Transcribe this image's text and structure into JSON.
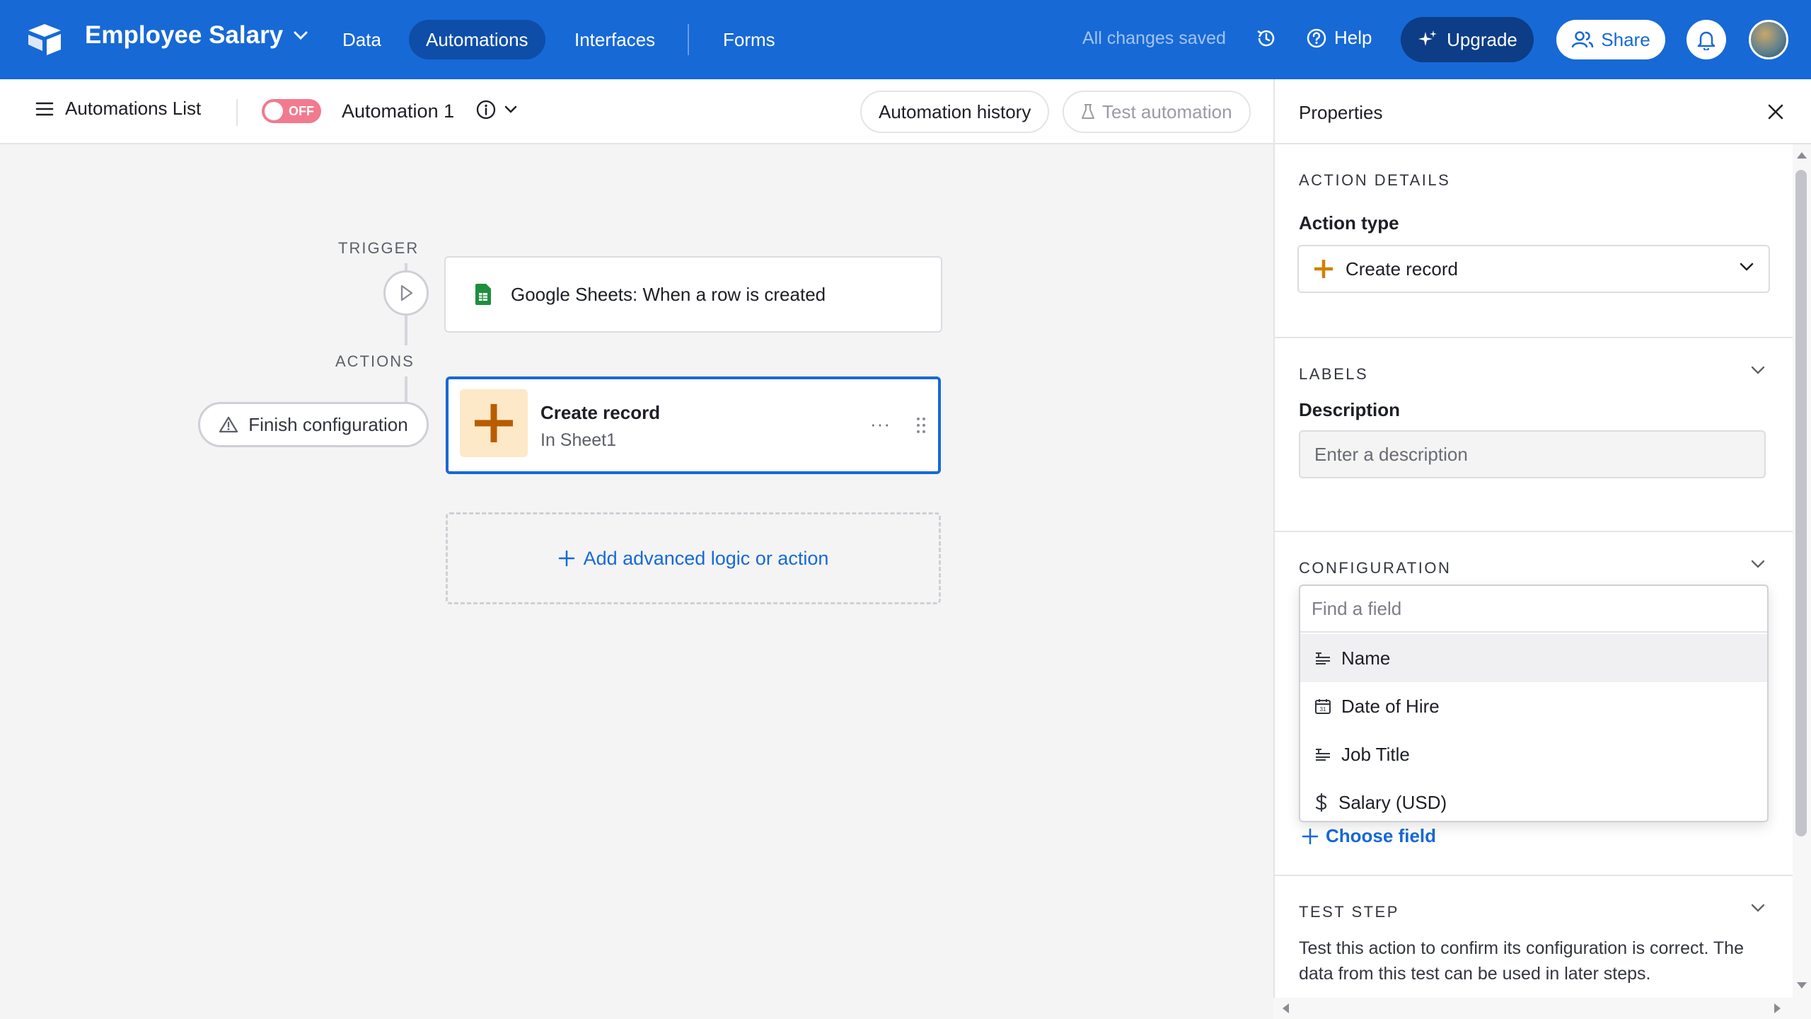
{
  "topbar": {
    "base_title": "Employee Salary",
    "tabs": [
      {
        "label": "Data"
      },
      {
        "label": "Automations",
        "active": true
      },
      {
        "label": "Interfaces"
      },
      {
        "label": "Forms"
      }
    ],
    "save_status": "All changes saved",
    "help_label": "Help",
    "upgrade_label": "Upgrade",
    "share_label": "Share",
    "colors": {
      "primary": "#1769d6",
      "active_tab": "#0e4ea9",
      "upgrade_bg": "#0d3d86"
    }
  },
  "subheader": {
    "list_label": "Automations List",
    "toggle_label": "OFF",
    "automation_name": "Automation 1",
    "history_label": "Automation history",
    "test_label": "Test automation"
  },
  "canvas": {
    "trigger_label": "TRIGGER",
    "actions_label": "ACTIONS",
    "trigger_text": "Google Sheets: When a row is created",
    "finish_label": "Finish configuration",
    "action": {
      "title": "Create record",
      "subtitle": "In Sheet1",
      "more": "···"
    },
    "add_logic_label": "Add advanced logic or action"
  },
  "panel": {
    "title": "Properties",
    "action_details_label": "ACTION DETAILS",
    "action_type_label": "Action type",
    "action_type_value": "Create record",
    "labels_section": "LABELS",
    "description_label": "Description",
    "description_placeholder": "Enter a description",
    "configuration_section": "CONFIGURATION",
    "find_placeholder": "Find a field",
    "fields": [
      {
        "label": "Name",
        "icon": "text-field-icon"
      },
      {
        "label": "Date of Hire",
        "icon": "calendar-icon"
      },
      {
        "label": "Job Title",
        "icon": "text-field-icon"
      },
      {
        "label": "Salary (USD)",
        "icon": "dollar-icon"
      }
    ],
    "choose_field_label": "Choose field",
    "test_step_section": "TEST STEP",
    "test_step_text": "Test this action to confirm its configuration is correct. The data from this test can be used in later steps."
  }
}
